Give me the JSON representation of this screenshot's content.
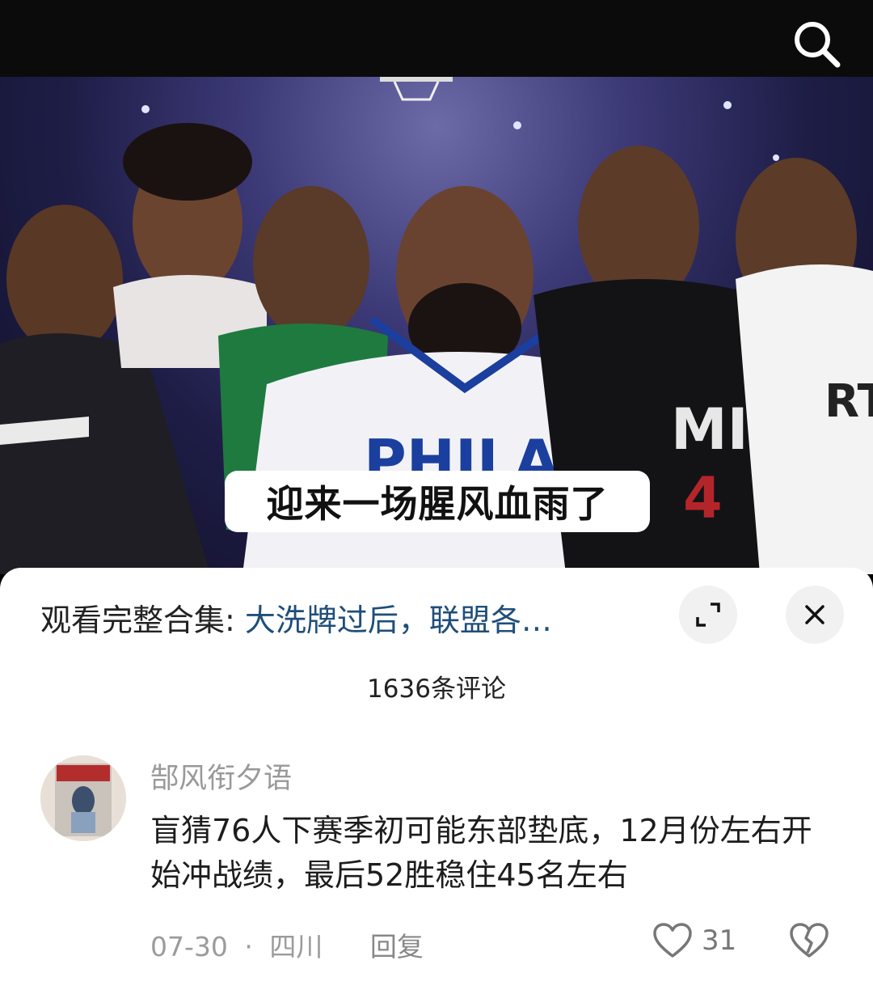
{
  "video": {
    "caption": "迎来一场腥风血雨了"
  },
  "collection": {
    "prefix": "观看完整合集: ",
    "title": "大洗牌过后，联盟各…"
  },
  "comments_count": "1636条评论",
  "comment": {
    "username": "郜风衔夕语",
    "text": "盲猜76人下赛季初可能东部垫底，12月份左右开始冲战绩，最后52胜稳住45名左右",
    "date": "07-30",
    "separator": "·",
    "location": "四川",
    "reply_label": "回复",
    "likes": "31"
  },
  "icons": {
    "search": "search-icon",
    "expand": "expand-icon",
    "close": "close-icon",
    "like": "heart-icon",
    "dislike": "broken-heart-icon"
  }
}
